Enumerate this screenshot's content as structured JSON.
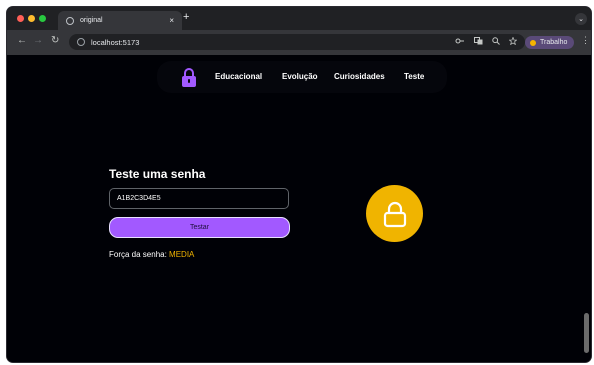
{
  "browser": {
    "tab_title": "original",
    "tab_close": "×",
    "new_tab": "+",
    "tab_search": "⌄",
    "url": "localhost:5173",
    "nav": {
      "back": "←",
      "forward": "→",
      "reload": "↻"
    },
    "profile_label": "Trabalho",
    "menu": "⋮",
    "icons": [
      "lens-icon",
      "translate-icon",
      "zoom-icon",
      "star-icon"
    ]
  },
  "navbar": {
    "links": [
      "Educacional",
      "Evolução",
      "Curiosidades",
      "Teste"
    ],
    "logo_color": "#a259ff"
  },
  "main": {
    "title": "Teste uma senha",
    "input_value": "A1B2C3D4E5",
    "button_label": "Testar",
    "strength_label": "Força da senha: ",
    "strength_value": "MEDIA",
    "strength_color": "#f0b400",
    "lock_color": "#f0b400"
  }
}
